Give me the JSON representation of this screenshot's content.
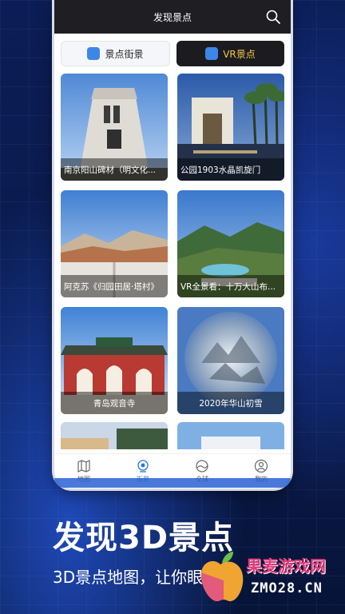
{
  "app": {
    "title": "发现景点"
  },
  "tabs": [
    {
      "label": "景点街景",
      "active": false
    },
    {
      "label": "VR景点",
      "active": true
    }
  ],
  "cards": [
    {
      "caption": "南京阳山碑材（明文化..."
    },
    {
      "caption": "公园1903水晶凯旋门"
    },
    {
      "caption": "阿克苏《归园田居·塔村》"
    },
    {
      "caption": "VR全景看：十万大山布..."
    },
    {
      "caption": "青岛观音寺"
    },
    {
      "caption": "2020年华山初雪"
    }
  ],
  "bottom_nav": [
    {
      "label": "地图",
      "icon": "map-icon",
      "active": false
    },
    {
      "label": "街景",
      "icon": "camera-icon",
      "active": true
    },
    {
      "label": "全球",
      "icon": "globe-icon",
      "active": false
    },
    {
      "label": "我的",
      "icon": "user-icon",
      "active": false
    }
  ],
  "promo": {
    "headline": "发现3D景点",
    "subline": "3D景点地图，让你眼探索"
  },
  "watermark": {
    "line1": "果麦游戏网",
    "line2": "ZMO28.CN"
  },
  "colors": {
    "accent": "#2b76d6",
    "tab_active_text": "#f2c84b",
    "background": "#0a1a4a"
  }
}
